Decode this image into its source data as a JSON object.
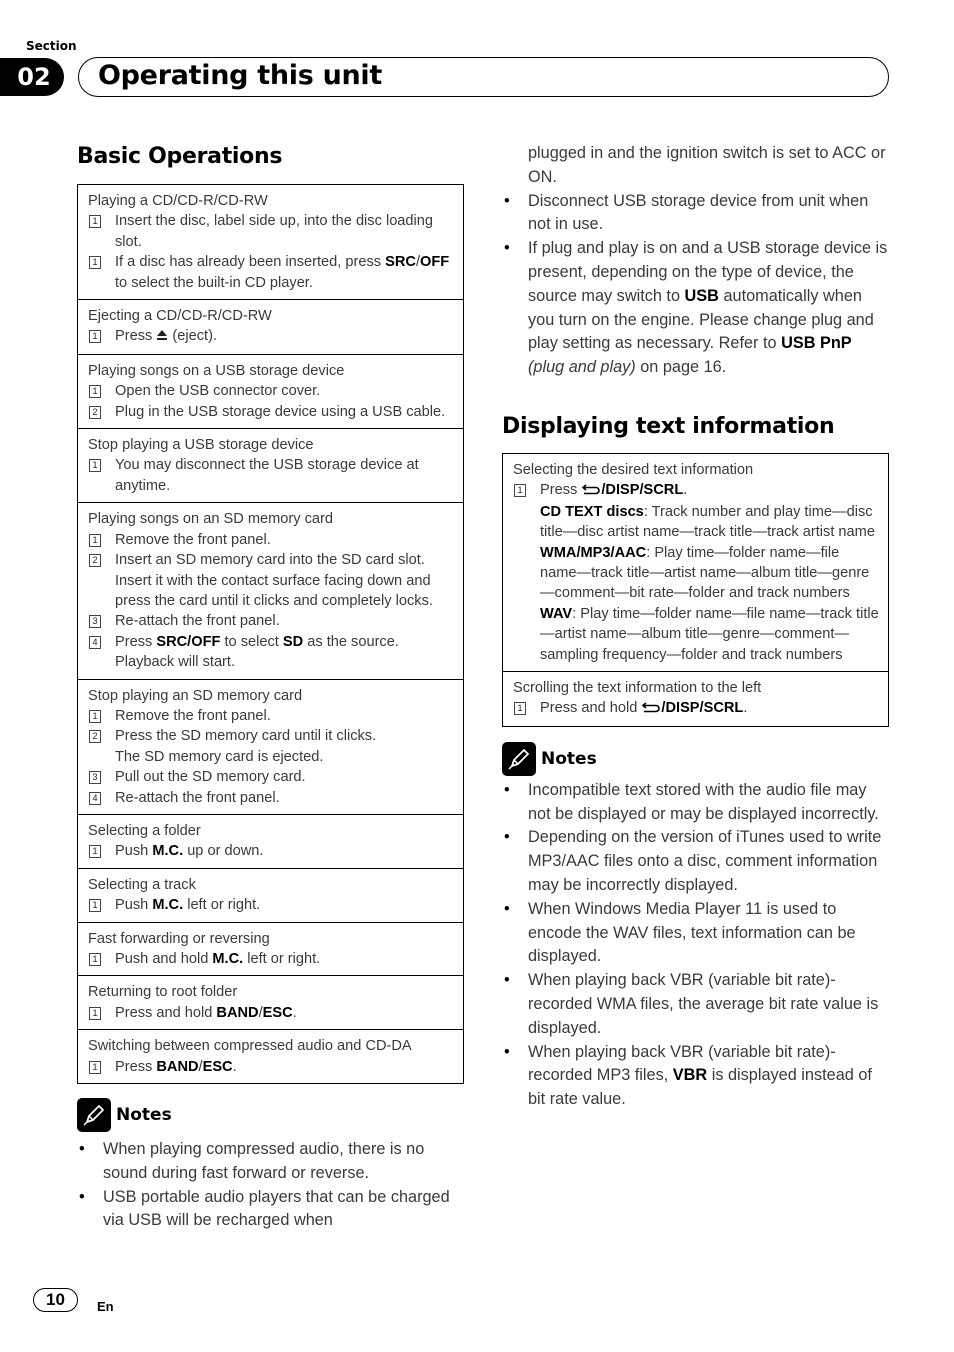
{
  "header": {
    "section_label": "Section",
    "section_number": "02",
    "title": "Operating this unit"
  },
  "basic_operations": {
    "heading": "Basic Operations",
    "blocks": [
      {
        "title": "Playing a CD/CD-R/CD-RW",
        "steps": [
          {
            "num": "1",
            "text": "Insert the disc, label side up, into the disc loading slot."
          },
          {
            "num": "1",
            "pre": "If a disc has already been inserted, press ",
            "bold1": "SRC",
            "mid": "/",
            "bold2": "OFF",
            "post": " to select the built-in CD player."
          }
        ]
      },
      {
        "title": "Ejecting a CD/CD-R/CD-RW",
        "steps": [
          {
            "num": "1",
            "pre": "Press ",
            "icon": "eject-icon",
            "post": " (eject)."
          }
        ]
      },
      {
        "title": "Playing songs on a USB storage device",
        "steps": [
          {
            "num": "1",
            "text": "Open the USB connector cover."
          },
          {
            "num": "2",
            "text": "Plug in the USB storage device using a USB cable."
          }
        ]
      },
      {
        "title": "Stop playing a USB storage device",
        "steps": [
          {
            "num": "1",
            "text": "You may disconnect the USB storage device at anytime."
          }
        ]
      },
      {
        "title": "Playing songs on an SD memory card",
        "steps": [
          {
            "num": "1",
            "text": "Remove the front panel."
          },
          {
            "num": "2",
            "text": "Insert an SD memory card into the SD card slot.",
            "cont": "Insert it with the contact surface facing down and press the card until it clicks and completely locks."
          },
          {
            "num": "3",
            "text": "Re-attach the front panel."
          },
          {
            "num": "4",
            "pre": "Press ",
            "bold1": "SRC/OFF",
            "mid": " to select ",
            "bold2": "SD",
            "post": " as the source.",
            "cont": "Playback will start."
          }
        ]
      },
      {
        "title": "Stop playing an SD memory card",
        "steps": [
          {
            "num": "1",
            "text": "Remove the front panel."
          },
          {
            "num": "2",
            "text": "Press the SD memory card until it clicks.",
            "cont": "The SD memory card is ejected."
          },
          {
            "num": "3",
            "text": "Pull out the SD memory card."
          },
          {
            "num": "4",
            "text": "Re-attach the front panel."
          }
        ]
      },
      {
        "title": "Selecting a folder",
        "steps": [
          {
            "num": "1",
            "pre": "Push ",
            "bold1": "M.C.",
            "post": " up or down."
          }
        ]
      },
      {
        "title": "Selecting a track",
        "steps": [
          {
            "num": "1",
            "pre": "Push ",
            "bold1": "M.C.",
            "post": " left or right."
          }
        ]
      },
      {
        "title": "Fast forwarding or reversing",
        "steps": [
          {
            "num": "1",
            "pre": "Push and hold ",
            "bold1": "M.C.",
            "post": " left or right."
          }
        ]
      },
      {
        "title": "Returning to root folder",
        "steps": [
          {
            "num": "1",
            "pre": "Press and hold ",
            "bold1": "BAND",
            "mid": "/",
            "bold2": "ESC",
            "post": "."
          }
        ]
      },
      {
        "title": "Switching between compressed audio and CD-DA",
        "steps": [
          {
            "num": "1",
            "pre": "Press ",
            "bold1": "BAND",
            "mid": "/",
            "bold2": "ESC",
            "post": "."
          }
        ]
      }
    ],
    "notes_label": "Notes",
    "notes": [
      "When playing compressed audio, there is no sound during fast forward or reverse.",
      "USB portable audio players that can be charged via USB will be recharged when"
    ]
  },
  "right_column": {
    "continued_note": "plugged in and the ignition switch is set to ACC or ON.",
    "notes": [
      {
        "text": "Disconnect USB storage device from unit when not in use."
      },
      {
        "pre": "If plug and play is on and a USB storage device is present, depending on the type of device, the source may switch to ",
        "bold1": "USB",
        "mid": " automatically when you turn on the engine. Please change plug and play setting as necessary. Refer to ",
        "bold2": "USB PnP",
        "italic": " (plug and play)",
        "post": " on page 16."
      }
    ]
  },
  "displaying_text": {
    "heading": "Displaying text information",
    "blocks": [
      {
        "title": "Selecting the desired text information",
        "step_num": "1",
        "press_pre": "Press ",
        "press_bold": "/DISP/SCRL",
        "press_post": ".",
        "entries": [
          {
            "label": "CD TEXT discs",
            "text": ": Track number and play time—disc title—disc artist name—track title—track artist name"
          },
          {
            "label": "WMA/MP3/AAC",
            "text": ": Play time—folder name—file name—track title—artist name—album title—genre—comment—bit rate—folder and track numbers"
          },
          {
            "label": "WAV",
            "text": ": Play time—folder name—file name—track title—artist name—album title—genre—comment—sampling frequency—folder and track numbers"
          }
        ]
      },
      {
        "title": "Scrolling the text information to the left",
        "step_num": "1",
        "press_pre": "Press and hold ",
        "press_bold": "/DISP/SCRL",
        "press_post": "."
      }
    ],
    "notes_label": "Notes",
    "notes": [
      {
        "text": "Incompatible text stored with the audio file may not be displayed or may be displayed incorrectly."
      },
      {
        "text": "Depending on the version of iTunes used to write MP3/AAC files onto a disc, comment information may be incorrectly displayed."
      },
      {
        "text": "When Windows Media Player 11 is used to encode the WAV files, text information can be displayed."
      },
      {
        "text": "When playing back VBR (variable bit rate)-recorded WMA files, the average bit rate value is displayed."
      },
      {
        "pre": "When playing back VBR (variable bit rate)-recorded MP3 files, ",
        "bold": "VBR",
        "post": " is displayed instead of bit rate value."
      }
    ]
  },
  "footer": {
    "page_number": "10",
    "language": "En"
  }
}
